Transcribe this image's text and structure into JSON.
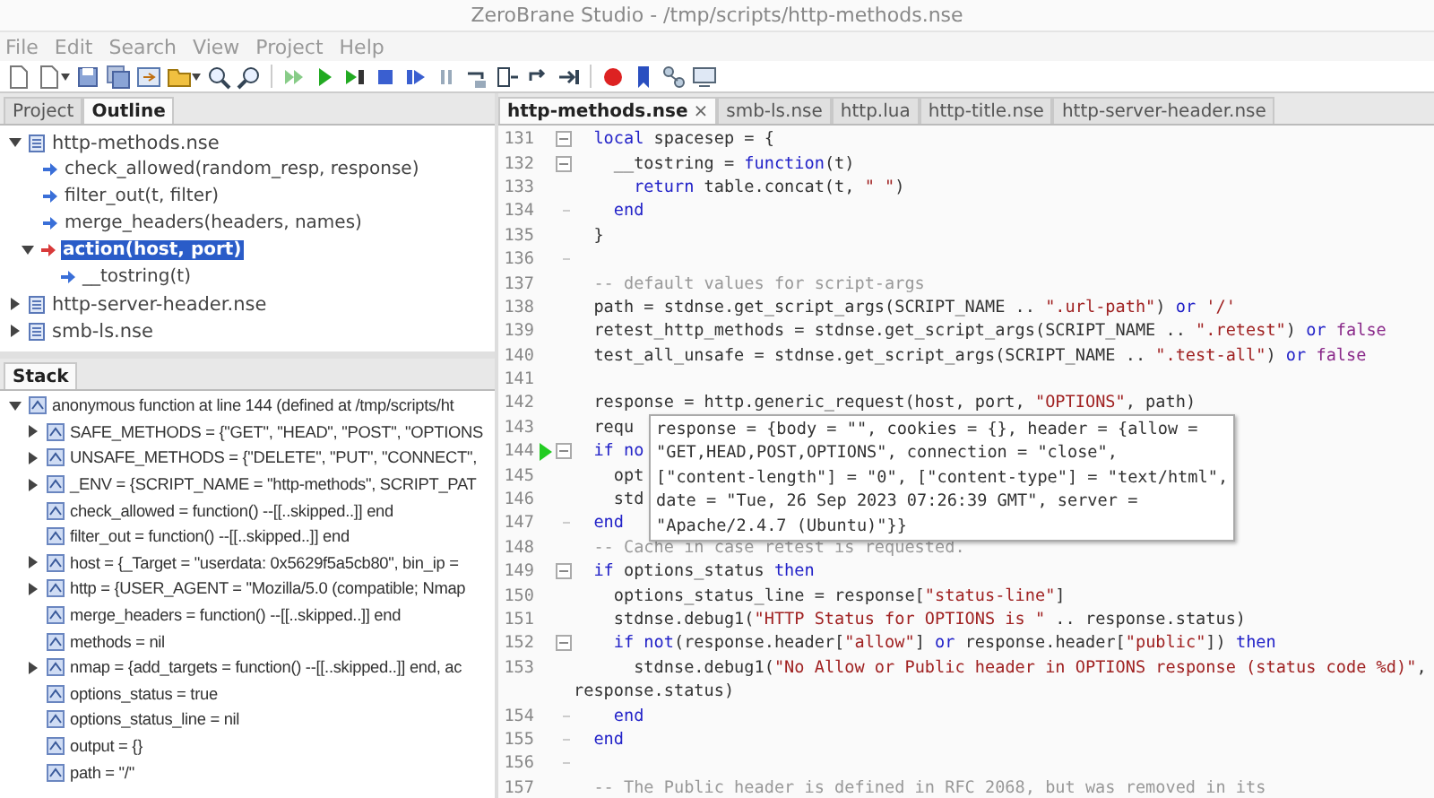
{
  "window": {
    "title": "ZeroBrane Studio - /tmp/scripts/http-methods.nse"
  },
  "menu": [
    "File",
    "Edit",
    "Search",
    "View",
    "Project",
    "Help"
  ],
  "left_tabs": [
    {
      "label": "Project",
      "selected": false
    },
    {
      "label": "Outline",
      "selected": true
    }
  ],
  "outline": [
    {
      "label": "http-methods.nse",
      "expanded": true,
      "selected": false,
      "children": [
        {
          "label": "check_allowed(random_resp, response)",
          "color": "#3a6fd8",
          "selected": false
        },
        {
          "label": "filter_out(t, filter)",
          "color": "#3a6fd8",
          "selected": false
        },
        {
          "label": "merge_headers(headers, names)",
          "color": "#3a6fd8",
          "selected": false
        },
        {
          "label": "action(host, port)",
          "color": "#d83a3a",
          "selected": true,
          "expanded": true,
          "children": [
            {
              "label": "__tostring(t)",
              "color": "#3a6fd8",
              "selected": false
            }
          ]
        }
      ]
    },
    {
      "label": "http-server-header.nse",
      "expanded": false,
      "selected": false
    },
    {
      "label": "smb-ls.nse",
      "expanded": false,
      "selected": false
    }
  ],
  "stack_tab": {
    "label": "Stack",
    "selected": true
  },
  "stack": [
    {
      "label": "anonymous function at line 144 (defined at /tmp/scripts/ht",
      "expanded": true,
      "children": [
        {
          "label": "SAFE_METHODS = {\"GET\", \"HEAD\", \"POST\", \"OPTIONS",
          "expanded": false
        },
        {
          "label": "UNSAFE_METHODS = {\"DELETE\", \"PUT\", \"CONNECT\",",
          "expanded": false
        },
        {
          "label": "_ENV = {SCRIPT_NAME = \"http-methods\", SCRIPT_PAT",
          "expanded": false
        },
        {
          "label": "check_allowed = function() --[[..skipped..]] end"
        },
        {
          "label": "filter_out = function() --[[..skipped..]] end"
        },
        {
          "label": "host = {_Target = \"userdata: 0x5629f5a5cb80\", bin_ip =",
          "expanded": false
        },
        {
          "label": "http = {USER_AGENT = \"Mozilla/5.0 (compatible; Nmap",
          "expanded": false
        },
        {
          "label": "merge_headers = function() --[[..skipped..]] end"
        },
        {
          "label": "methods = nil"
        },
        {
          "label": "nmap = {add_targets = function() --[[..skipped..]] end, ac",
          "expanded": false
        },
        {
          "label": "options_status = true"
        },
        {
          "label": "options_status_line = nil"
        },
        {
          "label": "output = {}"
        },
        {
          "label": "path = \"/\""
        }
      ]
    }
  ],
  "editor_tabs": [
    {
      "label": "http-methods.nse",
      "selected": true,
      "close": "×"
    },
    {
      "label": "smb-ls.nse",
      "selected": false
    },
    {
      "label": "http.lua",
      "selected": false
    },
    {
      "label": "http-title.nse",
      "selected": false
    },
    {
      "label": "http-server-header.nse",
      "selected": false
    }
  ],
  "code": [
    {
      "number": "131",
      "fold_toggle": true,
      "fold_end": false,
      "tokens": [
        {
          "text": "  local",
          "kind": "keyword"
        },
        {
          "text": " spacesep = {",
          "kind": "plain"
        }
      ]
    },
    {
      "number": "132",
      "fold_toggle": true,
      "fold_end": false,
      "tokens": [
        {
          "text": "    __tostring = ",
          "kind": "plain"
        },
        {
          "text": "function",
          "kind": "keyword"
        },
        {
          "text": "(t)",
          "kind": "plain"
        }
      ]
    },
    {
      "number": "133",
      "fold_toggle": false,
      "fold_end": false,
      "tokens": [
        {
          "text": "      return",
          "kind": "keyword"
        },
        {
          "text": " table.concat(t, ",
          "kind": "plain"
        },
        {
          "text": "\" \"",
          "kind": "string"
        },
        {
          "text": ")",
          "kind": "plain"
        }
      ]
    },
    {
      "number": "134",
      "fold_toggle": false,
      "fold_end": true,
      "tokens": [
        {
          "text": "    end",
          "kind": "keyword"
        }
      ]
    },
    {
      "number": "135",
      "fold_toggle": false,
      "fold_end": false,
      "tokens": [
        {
          "text": "  }",
          "kind": "plain"
        }
      ]
    },
    {
      "number": "136",
      "fold_toggle": false,
      "fold_end": true
    },
    {
      "number": "137",
      "fold_toggle": false,
      "fold_end": false,
      "tokens": [
        {
          "text": "  -- default values for script-args",
          "kind": "comment"
        }
      ]
    },
    {
      "number": "138",
      "fold_toggle": false,
      "fold_end": false,
      "tokens": [
        {
          "text": "  path = stdnse.get_script_args(SCRIPT_NAME .. ",
          "kind": "plain"
        },
        {
          "text": "\".url-path\"",
          "kind": "string"
        },
        {
          "text": ") ",
          "kind": "plain"
        },
        {
          "text": "or",
          "kind": "keyword"
        },
        {
          "text": " '/'",
          "kind": "string"
        }
      ]
    },
    {
      "number": "139",
      "fold_toggle": false,
      "fold_end": false,
      "tokens": [
        {
          "text": "  retest_http_methods = stdnse.get_script_args(SCRIPT_NAME .. ",
          "kind": "plain"
        },
        {
          "text": "\".retest\"",
          "kind": "string"
        },
        {
          "text": ") ",
          "kind": "plain"
        },
        {
          "text": "or",
          "kind": "keyword"
        },
        {
          "text": " false",
          "kind": "constant"
        }
      ]
    },
    {
      "number": "140",
      "fold_toggle": false,
      "fold_end": false,
      "tokens": [
        {
          "text": "  test_all_unsafe = stdnse.get_script_args(SCRIPT_NAME .. ",
          "kind": "plain"
        },
        {
          "text": "\".test-all\"",
          "kind": "string"
        },
        {
          "text": ") ",
          "kind": "plain"
        },
        {
          "text": "or",
          "kind": "keyword"
        },
        {
          "text": " false",
          "kind": "constant"
        }
      ]
    },
    {
      "number": "141",
      "fold_toggle": false,
      "fold_end": false
    },
    {
      "number": "142",
      "fold_toggle": false,
      "fold_end": false,
      "tokens": [
        {
          "text": "  response = http.generic_request(host, port, ",
          "kind": "plain"
        },
        {
          "text": "\"OPTIONS\"",
          "kind": "string"
        },
        {
          "text": ", path)",
          "kind": "plain"
        }
      ]
    },
    {
      "number": "143",
      "fold_toggle": false,
      "fold_end": false,
      "tokens": [
        {
          "text": "  requ",
          "kind": "plain"
        }
      ]
    },
    {
      "number": "144",
      "fold_toggle": true,
      "fold_end": false,
      "current": true,
      "tokens": [
        {
          "text": "  if no",
          "kind": "keyword"
        }
      ]
    },
    {
      "number": "145",
      "fold_toggle": false,
      "fold_end": false,
      "tokens": [
        {
          "text": "    opt",
          "kind": "plain"
        }
      ]
    },
    {
      "number": "146",
      "fold_toggle": false,
      "fold_end": false,
      "tokens": [
        {
          "text": "    std",
          "kind": "plain"
        }
      ]
    },
    {
      "number": "147",
      "fold_toggle": false,
      "fold_end": true,
      "tokens": [
        {
          "text": "  end",
          "kind": "keyword"
        }
      ]
    },
    {
      "number": "148",
      "fold_toggle": false,
      "fold_end": false,
      "tokens": [
        {
          "text": "  -- Cache in case retest is requested.",
          "kind": "comment"
        }
      ]
    },
    {
      "number": "149",
      "fold_toggle": true,
      "fold_end": false,
      "tokens": [
        {
          "text": "  if",
          "kind": "keyword"
        },
        {
          "text": " options_status ",
          "kind": "plain"
        },
        {
          "text": "then",
          "kind": "keyword"
        }
      ]
    },
    {
      "number": "150",
      "fold_toggle": false,
      "fold_end": false,
      "tokens": [
        {
          "text": "    options_status_line = response[",
          "kind": "plain"
        },
        {
          "text": "\"status-line\"",
          "kind": "string"
        },
        {
          "text": "]",
          "kind": "plain"
        }
      ]
    },
    {
      "number": "151",
      "fold_toggle": false,
      "fold_end": false,
      "tokens": [
        {
          "text": "    stdnse.debug1(",
          "kind": "plain"
        },
        {
          "text": "\"HTTP Status for OPTIONS is \"",
          "kind": "string"
        },
        {
          "text": " .. response.status)",
          "kind": "plain"
        }
      ]
    },
    {
      "number": "152",
      "fold_toggle": true,
      "fold_end": false,
      "tokens": [
        {
          "text": "    if not",
          "kind": "keyword"
        },
        {
          "text": "(response.header[",
          "kind": "plain"
        },
        {
          "text": "\"allow\"",
          "kind": "string"
        },
        {
          "text": "] ",
          "kind": "plain"
        },
        {
          "text": "or",
          "kind": "keyword"
        },
        {
          "text": " response.header[",
          "kind": "plain"
        },
        {
          "text": "\"public\"",
          "kind": "string"
        },
        {
          "text": "]) ",
          "kind": "plain"
        },
        {
          "text": "then",
          "kind": "keyword"
        }
      ]
    },
    {
      "number": "153",
      "fold_toggle": false,
      "fold_end": false,
      "tokens": [
        {
          "text": "      stdnse.debug1(",
          "kind": "plain"
        },
        {
          "text": "\"No Allow or Public header in OPTIONS response (status code %d)\"",
          "kind": "string"
        },
        {
          "text": ",",
          "kind": "plain"
        }
      ],
      "wrap": "response.status)"
    },
    {
      "number": "154",
      "fold_toggle": false,
      "fold_end": true,
      "tokens": [
        {
          "text": "    end",
          "kind": "keyword"
        }
      ]
    },
    {
      "number": "155",
      "fold_toggle": false,
      "fold_end": true,
      "tokens": [
        {
          "text": "  end",
          "kind": "keyword"
        }
      ]
    },
    {
      "number": "156",
      "fold_toggle": false,
      "fold_end": true
    },
    {
      "number": "157",
      "fold_toggle": false,
      "fold_end": false,
      "tokens": [
        {
          "text": "  -- The Public header is defined in RFC 2068, but was removed in its",
          "kind": "comment"
        }
      ]
    }
  ],
  "tooltip": {
    "lines": [
      "response = {body = \"\", cookies = {}, header = {allow =",
      "\"GET,HEAD,POST,OPTIONS\", connection = \"close\",",
      "[\"content-length\"] = \"0\", [\"content-type\"] = \"text/html\",",
      "date = \"Tue, 26 Sep 2023 07:26:39 GMT\", server =",
      "\"Apache/2.4.7 (Ubuntu)\"}}"
    ]
  }
}
